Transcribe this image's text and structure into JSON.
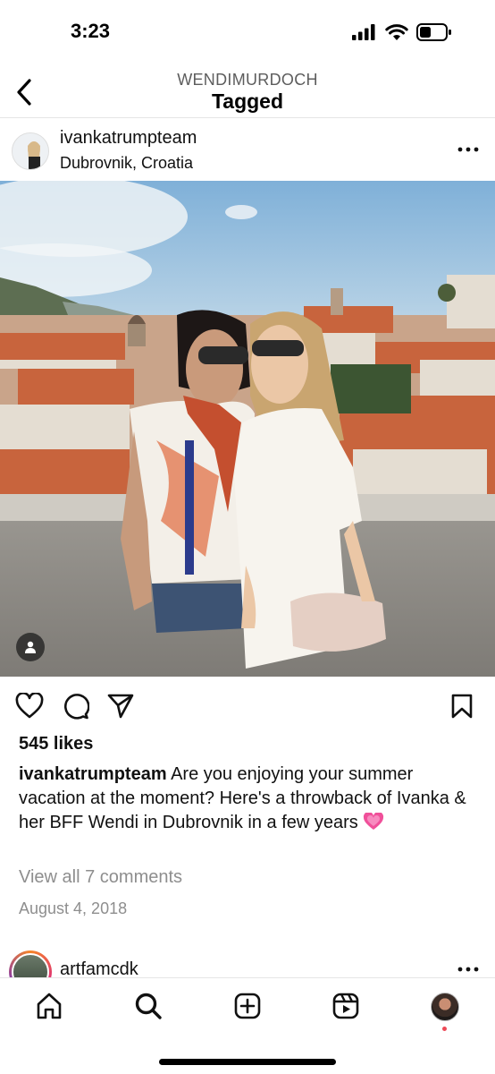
{
  "status_bar": {
    "time": "3:23",
    "icons": [
      "cellular-signal-icon",
      "wifi-icon",
      "battery-icon"
    ]
  },
  "header": {
    "subtitle": "WENDIMURDOCH",
    "title": "Tagged",
    "back_icon": "chevron-left-icon"
  },
  "post": {
    "username": "ivankatrumpteam",
    "location": "Dubrovnik, Croatia",
    "more_icon": "ellipsis-icon",
    "tag_icon": "person-tag-icon",
    "actions": [
      "heart-icon",
      "comment-icon",
      "share-icon",
      "bookmark-icon"
    ],
    "likes": "545 likes",
    "caption_user": "ivankatrumpteam",
    "caption_text": "Are you enjoying your summer vacation at the moment? Here's a throwback of Ivanka & her BFF Wendi in Dubrovnik in a few years",
    "caption_emoji": "💓",
    "view_comments": "View all 7 comments",
    "date": "August 4, 2018"
  },
  "next_post": {
    "username": "artfamcdk"
  },
  "tab_bar": {
    "tabs": [
      "home-icon",
      "search-icon",
      "new-post-icon",
      "reels-icon",
      "profile-avatar"
    ]
  },
  "colors": {
    "text": "#111111",
    "secondary_text": "#8e8e8e",
    "header_subtitle": "#5d5d5d",
    "notification": "#ed4956",
    "emoji_heart": "#f0509a"
  }
}
